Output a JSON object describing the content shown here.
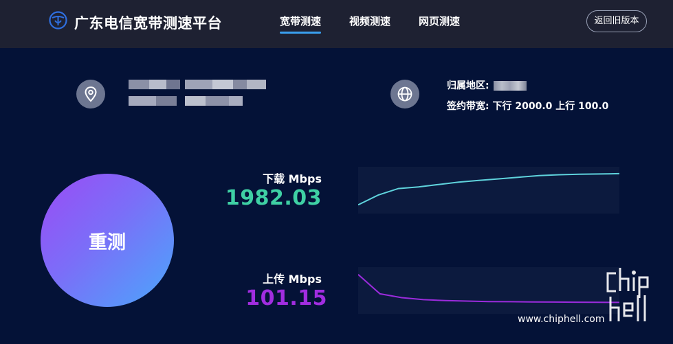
{
  "header": {
    "brand": "广东电信宽带测速平台",
    "tabs": [
      {
        "label": "宽带测速",
        "active": true
      },
      {
        "label": "视频测速",
        "active": false
      },
      {
        "label": "网页测速",
        "active": false
      }
    ],
    "old_version_label": "返回旧版本"
  },
  "info": {
    "region_label": "归属地区:",
    "bandwidth_label": "签约带宽:",
    "bandwidth_value": "下行 2000.0 上行 100.0"
  },
  "retest_label": "重测",
  "download": {
    "label": "下载 Mbps",
    "value": "1982.03",
    "color": "#3fd0a4",
    "line_color": "#5fd3dc",
    "trend": [
      1790,
      1850,
      1890,
      1900,
      1915,
      1930,
      1940,
      1950,
      1960,
      1970,
      1975,
      1978,
      1980,
      1982
    ]
  },
  "upload": {
    "label": "上传 Mbps",
    "value": "101.15",
    "color": "#a12de0",
    "line_color": "#9b2bdc",
    "trend": [
      130,
      110,
      106,
      104,
      103,
      102.5,
      102,
      101.8,
      101.6,
      101.5,
      101.3,
      101.2,
      101.15
    ]
  },
  "watermark": {
    "site": "www.chiphell.com",
    "logo_text": "chip hell"
  },
  "icons": {
    "logo": "china-telecom-logo-icon",
    "location": "map-pin-icon",
    "globe": "globe-icon"
  }
}
